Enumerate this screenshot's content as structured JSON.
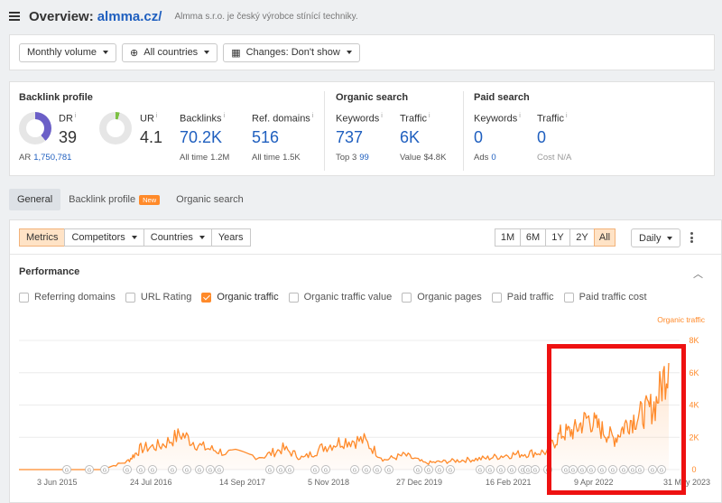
{
  "header": {
    "title": "Overview:",
    "domain": "almma.cz/",
    "subtitle": "Almma s.r.o. je český výrobce stínící techniky."
  },
  "filters": {
    "volume": "Monthly volume",
    "countries": "All countries",
    "changes": "Changes: Don't show"
  },
  "metrics": {
    "backlink": {
      "title": "Backlink profile",
      "dr_label": "DR",
      "dr_value": "39",
      "ar_label": "AR",
      "ar_value": "1,750,781",
      "ur_label": "UR",
      "ur_value": "4.1",
      "backlinks_label": "Backlinks",
      "backlinks_value": "70.2K",
      "backlinks_sub_label": "All time",
      "backlinks_sub_value": "1.2M",
      "refdomains_label": "Ref. domains",
      "refdomains_value": "516",
      "refdomains_sub_label": "All time",
      "refdomains_sub_value": "1.5K",
      "dr_fraction": 0.39,
      "ur_fraction": 0.041
    },
    "organic": {
      "title": "Organic search",
      "keywords_label": "Keywords",
      "keywords_value": "737",
      "keywords_sub_label": "Top 3",
      "keywords_sub_value": "99",
      "traffic_label": "Traffic",
      "traffic_value": "6K",
      "traffic_sub_label": "Value",
      "traffic_sub_value": "$4.8K"
    },
    "paid": {
      "title": "Paid search",
      "keywords_label": "Keywords",
      "keywords_value": "0",
      "keywords_sub_label": "Ads",
      "keywords_sub_value": "0",
      "traffic_label": "Traffic",
      "traffic_value": "0",
      "traffic_sub_label": "Cost",
      "traffic_sub_value": "N/A"
    }
  },
  "tabs": {
    "general": "General",
    "backlink": "Backlink profile",
    "new_badge": "New",
    "organic": "Organic search"
  },
  "toolbar": {
    "metrics": "Metrics",
    "competitors": "Competitors",
    "countries": "Countries",
    "years": "Years",
    "range": [
      "1M",
      "6M",
      "1Y",
      "2Y",
      "All"
    ],
    "range_selected": "All",
    "granularity": "Daily"
  },
  "performance": {
    "title": "Performance",
    "checkboxes": [
      {
        "label": "Referring domains",
        "checked": false
      },
      {
        "label": "URL Rating",
        "checked": false
      },
      {
        "label": "Organic traffic",
        "checked": true
      },
      {
        "label": "Organic traffic value",
        "checked": false
      },
      {
        "label": "Organic pages",
        "checked": false
      },
      {
        "label": "Paid traffic",
        "checked": false
      },
      {
        "label": "Paid traffic cost",
        "checked": false
      }
    ]
  },
  "colors": {
    "accent": "#ff8a2a",
    "link": "#1f5fbf",
    "highlight": "#ee1111",
    "dr_donut": "#6b5fc7",
    "ur_donut": "#7cc043"
  },
  "chart_data": {
    "type": "area",
    "series": [
      {
        "name": "Organic traffic"
      }
    ],
    "x_tick_labels": [
      "3 Jun 2015",
      "24 Jul 2016",
      "14 Sep 2017",
      "5 Nov 2018",
      "27 Dec 2019",
      "16 Feb 2021",
      "9 Apr 2022",
      "31 May 2023"
    ],
    "y_tick_labels": [
      "0",
      "2K",
      "4K",
      "6K",
      "8K"
    ],
    "ylim": [
      0,
      8000
    ],
    "x": [
      "2015-06",
      "2015-12",
      "2016-06",
      "2016-10",
      "2016-12",
      "2017-03",
      "2017-06",
      "2017-09",
      "2017-12",
      "2018-06",
      "2018-09",
      "2018-12",
      "2019-03",
      "2019-06",
      "2019-09",
      "2019-12",
      "2020-03",
      "2020-06",
      "2020-09",
      "2020-12",
      "2021-03",
      "2021-06",
      "2021-09",
      "2021-12",
      "2022-02",
      "2022-04",
      "2022-06",
      "2022-08",
      "2022-10",
      "2022-12",
      "2023-02",
      "2023-04",
      "2023-06"
    ],
    "values": [
      0,
      0,
      0,
      500,
      1300,
      1500,
      2200,
      1400,
      1100,
      800,
      1300,
      700,
      1400,
      1800,
      1800,
      600,
      900,
      400,
      500,
      600,
      700,
      900,
      1000,
      1100,
      2200,
      2400,
      3200,
      2500,
      1900,
      3000,
      3400,
      4000,
      6600
    ]
  }
}
